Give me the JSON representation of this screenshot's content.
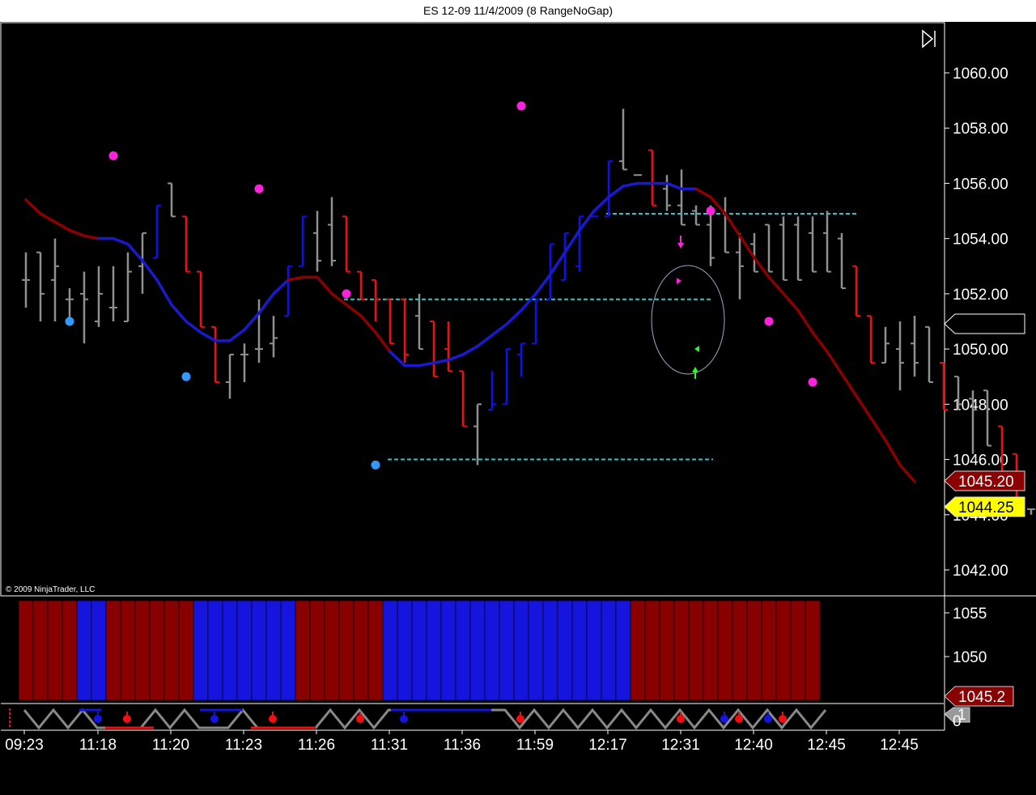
{
  "window": {
    "title": "ES 12-09  11/4/2009 (8 RangeNoGap)"
  },
  "copyright": "© 2009 NinjaTrader, LLC",
  "colors": {
    "background": "#000000",
    "up_bar": "#1010ee",
    "down_bar": "#ee1010",
    "neutral_bar": "#909090",
    "ma_down": "#8b0000",
    "ma_up": "#1a1acc",
    "swing_high": "#ff22dd",
    "swing_low": "#3399ff",
    "level_line": "#22cccc",
    "price_marker_ma": "#8b0000",
    "price_marker_last": "#ffff00"
  },
  "chart_data": [
    {
      "type": "bar",
      "subtype": "ohlc-range-bars",
      "ylim": [
        1041.0,
        1062.0
      ],
      "yticks": [
        "1042.00",
        "1044.00",
        "1046.00",
        "1048.00",
        "1050.00",
        "1052.00",
        "1054.00",
        "1056.00",
        "1058.00",
        "1060.00"
      ],
      "xtick_labels": [
        "09:23",
        "11:18",
        "11:20",
        "11:23",
        "11:26",
        "11:31",
        "11:36",
        "11:59",
        "12:17",
        "12:31",
        "12:40",
        "12:45",
        "12:45"
      ],
      "bars": [
        {
          "o": 1052.5,
          "h": 1053.5,
          "l": 1051.5,
          "c": 1052.5,
          "color": "neutral"
        },
        {
          "o": 1053.5,
          "h": 1053.5,
          "l": 1051.0,
          "c": 1052.0,
          "color": "neutral"
        },
        {
          "o": 1052.5,
          "h": 1054.0,
          "l": 1051.0,
          "c": 1053.0,
          "color": "neutral"
        },
        {
          "o": 1051.8,
          "h": 1052.2,
          "l": 1051.0,
          "c": 1051.8,
          "color": "neutral"
        },
        {
          "o": 1052.0,
          "h": 1052.8,
          "l": 1050.2,
          "c": 1051.8,
          "color": "neutral"
        },
        {
          "o": 1051.0,
          "h": 1053.0,
          "l": 1050.8,
          "c": 1052.0,
          "color": "neutral"
        },
        {
          "o": 1051.5,
          "h": 1053.0,
          "l": 1051.0,
          "c": 1051.5,
          "color": "neutral"
        },
        {
          "o": 1051.0,
          "h": 1053.5,
          "l": 1051.0,
          "c": 1052.8,
          "color": "neutral"
        },
        {
          "o": 1053.0,
          "h": 1054.2,
          "l": 1052.0,
          "c": 1054.2,
          "color": "neutral"
        },
        {
          "o": 1053.3,
          "h": 1055.2,
          "l": 1053.3,
          "c": 1055.2,
          "color": "up"
        },
        {
          "o": 1056.0,
          "h": 1056.0,
          "l": 1054.8,
          "c": 1054.8,
          "color": "neutral"
        },
        {
          "o": 1054.8,
          "h": 1054.8,
          "l": 1052.8,
          "c": 1052.8,
          "color": "down"
        },
        {
          "o": 1052.8,
          "h": 1052.8,
          "l": 1050.8,
          "c": 1050.8,
          "color": "down"
        },
        {
          "o": 1050.8,
          "h": 1050.8,
          "l": 1048.8,
          "c": 1048.8,
          "color": "down"
        },
        {
          "o": 1048.8,
          "h": 1049.8,
          "l": 1048.2,
          "c": 1049.8,
          "color": "neutral"
        },
        {
          "o": 1049.8,
          "h": 1050.2,
          "l": 1048.8,
          "c": 1049.8,
          "color": "neutral"
        },
        {
          "o": 1050.0,
          "h": 1051.8,
          "l": 1049.5,
          "c": 1050.0,
          "color": "neutral"
        },
        {
          "o": 1050.2,
          "h": 1051.2,
          "l": 1049.7,
          "c": 1050.4,
          "color": "neutral"
        },
        {
          "o": 1051.2,
          "h": 1053.0,
          "l": 1051.2,
          "c": 1053.0,
          "color": "up"
        },
        {
          "o": 1053.0,
          "h": 1054.8,
          "l": 1053.0,
          "c": 1054.8,
          "color": "up"
        },
        {
          "o": 1054.2,
          "h": 1055.0,
          "l": 1052.8,
          "c": 1053.2,
          "color": "neutral"
        },
        {
          "o": 1054.5,
          "h": 1055.5,
          "l": 1053.0,
          "c": 1053.2,
          "color": "neutral"
        },
        {
          "o": 1054.8,
          "h": 1054.8,
          "l": 1052.8,
          "c": 1052.8,
          "color": "down"
        },
        {
          "o": 1052.8,
          "h": 1052.8,
          "l": 1051.8,
          "c": 1051.8,
          "color": "down"
        },
        {
          "o": 1052.5,
          "h": 1052.5,
          "l": 1051.0,
          "c": 1051.8,
          "color": "down"
        },
        {
          "o": 1051.8,
          "h": 1051.8,
          "l": 1050.2,
          "c": 1050.2,
          "color": "down"
        },
        {
          "o": 1051.8,
          "h": 1051.8,
          "l": 1049.5,
          "c": 1049.8,
          "color": "down"
        },
        {
          "o": 1051.2,
          "h": 1052.0,
          "l": 1050.0,
          "c": 1050.0,
          "color": "neutral"
        },
        {
          "o": 1051.0,
          "h": 1051.0,
          "l": 1049.0,
          "c": 1049.0,
          "color": "down"
        },
        {
          "o": 1050.0,
          "h": 1051.0,
          "l": 1049.2,
          "c": 1049.2,
          "color": "down"
        },
        {
          "o": 1049.2,
          "h": 1049.2,
          "l": 1047.2,
          "c": 1047.2,
          "color": "down"
        },
        {
          "o": 1047.2,
          "h": 1048.0,
          "l": 1045.8,
          "c": 1048.0,
          "color": "neutral"
        },
        {
          "o": 1047.8,
          "h": 1049.2,
          "l": 1047.8,
          "c": 1048.0,
          "color": "up"
        },
        {
          "o": 1048.0,
          "h": 1050.0,
          "l": 1048.0,
          "c": 1050.0,
          "color": "up"
        },
        {
          "o": 1049.8,
          "h": 1050.2,
          "l": 1049.0,
          "c": 1050.2,
          "color": "up"
        },
        {
          "o": 1050.2,
          "h": 1051.8,
          "l": 1050.2,
          "c": 1051.8,
          "color": "up"
        },
        {
          "o": 1051.8,
          "h": 1053.8,
          "l": 1051.8,
          "c": 1053.8,
          "color": "up"
        },
        {
          "o": 1052.5,
          "h": 1054.2,
          "l": 1052.5,
          "c": 1054.2,
          "color": "up"
        },
        {
          "o": 1053.0,
          "h": 1054.8,
          "l": 1052.8,
          "c": 1054.8,
          "color": "up"
        },
        {
          "o": 1054.8,
          "h": 1054.8,
          "l": 1054.8,
          "c": 1054.8,
          "color": "up"
        },
        {
          "o": 1054.8,
          "h": 1056.8,
          "l": 1054.8,
          "c": 1056.8,
          "color": "up"
        },
        {
          "o": 1056.8,
          "h": 1058.7,
          "l": 1056.5,
          "c": 1056.5,
          "color": "neutral"
        },
        {
          "o": 1056.3,
          "h": 1056.3,
          "l": 1056.3,
          "c": 1056.3,
          "color": "neutral"
        },
        {
          "o": 1057.2,
          "h": 1057.2,
          "l": 1055.2,
          "c": 1055.2,
          "color": "down"
        },
        {
          "o": 1055.8,
          "h": 1056.3,
          "l": 1055.0,
          "c": 1055.2,
          "color": "neutral"
        },
        {
          "o": 1055.2,
          "h": 1056.5,
          "l": 1054.5,
          "c": 1054.5,
          "color": "neutral"
        },
        {
          "o": 1055.0,
          "h": 1055.2,
          "l": 1054.5,
          "c": 1054.5,
          "color": "neutral"
        },
        {
          "o": 1054.5,
          "h": 1055.2,
          "l": 1053.0,
          "c": 1053.3,
          "color": "neutral"
        },
        {
          "o": 1055.0,
          "h": 1055.5,
          "l": 1053.5,
          "c": 1053.5,
          "color": "neutral"
        },
        {
          "o": 1053.5,
          "h": 1054.2,
          "l": 1051.8,
          "c": 1053.0,
          "color": "neutral"
        },
        {
          "o": 1053.8,
          "h": 1054.2,
          "l": 1052.8,
          "c": 1052.8,
          "color": "neutral"
        },
        {
          "o": 1054.5,
          "h": 1054.5,
          "l": 1052.8,
          "c": 1052.8,
          "color": "neutral"
        },
        {
          "o": 1054.5,
          "h": 1054.8,
          "l": 1052.5,
          "c": 1052.5,
          "color": "neutral"
        },
        {
          "o": 1054.5,
          "h": 1054.8,
          "l": 1052.5,
          "c": 1052.5,
          "color": "neutral"
        },
        {
          "o": 1054.2,
          "h": 1054.8,
          "l": 1052.8,
          "c": 1052.8,
          "color": "neutral"
        },
        {
          "o": 1054.2,
          "h": 1055.0,
          "l": 1052.8,
          "c": 1052.8,
          "color": "neutral"
        },
        {
          "o": 1054.0,
          "h": 1054.2,
          "l": 1052.2,
          "c": 1052.2,
          "color": "neutral"
        },
        {
          "o": 1053.0,
          "h": 1053.0,
          "l": 1051.2,
          "c": 1051.2,
          "color": "down"
        },
        {
          "o": 1051.2,
          "h": 1051.2,
          "l": 1049.5,
          "c": 1049.5,
          "color": "down"
        },
        {
          "o": 1049.5,
          "h": 1050.8,
          "l": 1049.5,
          "c": 1050.2,
          "color": "neutral"
        },
        {
          "o": 1050.0,
          "h": 1051.0,
          "l": 1048.5,
          "c": 1049.5,
          "color": "neutral"
        },
        {
          "o": 1050.2,
          "h": 1051.2,
          "l": 1049.0,
          "c": 1049.5,
          "color": "neutral"
        },
        {
          "o": 1050.8,
          "h": 1050.8,
          "l": 1048.8,
          "c": 1048.8,
          "color": "neutral"
        },
        {
          "o": 1049.5,
          "h": 1049.5,
          "l": 1047.8,
          "c": 1047.8,
          "color": "down"
        },
        {
          "o": 1049.0,
          "h": 1049.0,
          "l": 1047.8,
          "c": 1048.0,
          "color": "neutral"
        },
        {
          "o": 1048.2,
          "h": 1048.5,
          "l": 1046.2,
          "c": 1047.8,
          "color": "neutral"
        },
        {
          "o": 1048.5,
          "h": 1048.5,
          "l": 1046.5,
          "c": 1046.5,
          "color": "neutral"
        },
        {
          "o": 1047.2,
          "h": 1047.2,
          "l": 1045.2,
          "c": 1045.2,
          "color": "down"
        },
        {
          "o": 1046.2,
          "h": 1046.2,
          "l": 1044.2,
          "c": 1044.2,
          "color": "down"
        },
        {
          "o": 1044.2,
          "h": 1044.2,
          "l": 1044.0,
          "c": 1044.2,
          "color": "neutral"
        }
      ],
      "moving_average": [
        1055.4,
        1054.9,
        1054.6,
        1054.3,
        1054.1,
        1054.0,
        1054.0,
        1053.8,
        1053.2,
        1052.5,
        1051.6,
        1051.0,
        1050.6,
        1050.3,
        1050.3,
        1050.7,
        1051.3,
        1052.0,
        1052.5,
        1052.6,
        1052.6,
        1052.0,
        1051.6,
        1051.2,
        1050.6,
        1049.9,
        1049.4,
        1049.4,
        1049.5,
        1049.6,
        1049.8,
        1050.1,
        1050.5,
        1050.9,
        1051.4,
        1052.0,
        1052.7,
        1053.5,
        1054.3,
        1055.0,
        1055.5,
        1055.9,
        1056.0,
        1056.0,
        1056.0,
        1055.8,
        1055.8,
        1055.5,
        1054.9,
        1054.1,
        1053.3,
        1052.6,
        1052.0,
        1051.4,
        1050.6,
        1049.9,
        1049.1,
        1048.3,
        1047.5,
        1046.7,
        1045.8,
        1045.2
      ],
      "ma_colors": [
        "down",
        "down",
        "down",
        "down",
        "down",
        "up",
        "up",
        "up",
        "up",
        "up",
        "up",
        "up",
        "up",
        "up",
        "up",
        "up",
        "up",
        "up",
        "down",
        "down",
        "down",
        "down",
        "down",
        "down",
        "down",
        "up",
        "up",
        "up",
        "up",
        "up",
        "up",
        "up",
        "up",
        "up",
        "up",
        "up",
        "up",
        "up",
        "up",
        "up",
        "up",
        "up",
        "up",
        "up",
        "up",
        "up",
        "down",
        "down",
        "down",
        "down",
        "down",
        "down",
        "down",
        "down",
        "down",
        "down",
        "down",
        "down",
        "down",
        "down",
        "down",
        "down"
      ],
      "swing_high_markers": [
        {
          "bar": 6,
          "price": 1057.0
        },
        {
          "bar": 16,
          "price": 1055.8
        },
        {
          "bar": 22,
          "price": 1052.0
        },
        {
          "bar": 34,
          "price": 1058.8
        },
        {
          "bar": 47,
          "price": 1055.0
        },
        {
          "bar": 51,
          "price": 1051.0
        },
        {
          "bar": 54,
          "price": 1048.8
        }
      ],
      "swing_low_markers": [
        {
          "bar": 3,
          "price": 1051.0
        },
        {
          "bar": 11,
          "price": 1049.0
        },
        {
          "bar": 24,
          "price": 1045.8
        }
      ],
      "level_lines": [
        {
          "price": 1054.9,
          "from_bar": 40,
          "to_bar": 57
        },
        {
          "price": 1051.8,
          "from_bar": 22,
          "to_bar": 47
        },
        {
          "price": 1046.0,
          "from_bar": 25,
          "to_bar": 47
        }
      ],
      "price_markers": [
        {
          "label": "1045.20",
          "price": 1045.2,
          "kind": "ma"
        },
        {
          "label": "1044.25",
          "price": 1044.25,
          "kind": "last"
        }
      ],
      "current_price_text": "1044.25"
    },
    {
      "type": "bar",
      "subtype": "trend-columns",
      "yticks": [
        "1055",
        "1050"
      ],
      "ylim": [
        1044,
        1057
      ],
      "columns": [
        "down",
        "down",
        "down",
        "down",
        "up",
        "up",
        "down",
        "down",
        "down",
        "down",
        "down",
        "down",
        "up",
        "up",
        "up",
        "up",
        "up",
        "up",
        "up",
        "down",
        "down",
        "down",
        "down",
        "down",
        "down",
        "up",
        "up",
        "up",
        "up",
        "up",
        "up",
        "up",
        "up",
        "up",
        "up",
        "up",
        "up",
        "up",
        "up",
        "up",
        "up",
        "up",
        "down",
        "down",
        "down",
        "down",
        "down",
        "down",
        "down",
        "down",
        "down",
        "down",
        "down",
        "down",
        "down"
      ],
      "price_marker": {
        "label": "1045.2",
        "value": 1045.2
      }
    },
    {
      "type": "line",
      "subtype": "oscillator",
      "marker_label": "1",
      "ylim": [
        0,
        1
      ],
      "ytick_visible": "0"
    }
  ]
}
